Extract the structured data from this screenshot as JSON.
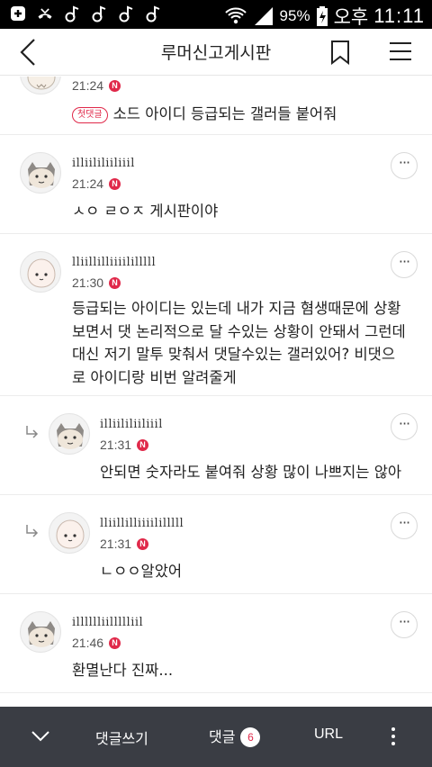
{
  "status_bar": {
    "battery": "95%",
    "ampm": "오후",
    "time": "11:11"
  },
  "header": {
    "title": "루머신고게시판"
  },
  "comments": [
    {
      "time": "21:24",
      "badge": "N",
      "first_tag": "첫댓글",
      "text": "소드 아이디 등급되는 갤러들 붙어줘"
    },
    {
      "username": "illiililiiliiil",
      "time": "21:24",
      "badge": "N",
      "text": "ㅅㅇ ㄹㅇㅈ 게시판이야",
      "more": "···"
    },
    {
      "username": "lliillilliiiililllll",
      "time": "21:30",
      "badge": "N",
      "lines": [
        "등급되는 아이디는 있는데 내가 지금 혐생때문에 상황",
        "보면서 댓 논리적으로 달 수있는 상황이 안돼서 그런데",
        "대신 저기 말투 맞춰서 댓달수있는 갤러있어? 비댓으",
        "로 아이디랑 비번 알려줄게"
      ],
      "more": "···"
    },
    {
      "username": "illiililiiliiil",
      "time": "21:31",
      "badge": "N",
      "text": "안되면 숫자라도 붙여줘 상황 많이 나쁘지는 않아",
      "more": "···"
    },
    {
      "username": "lliillilliiiililllll",
      "time": "21:31",
      "badge": "N",
      "text": "ㄴㅇㅇ알았어",
      "more": "···"
    },
    {
      "username": "illlllliillllliil",
      "time": "21:46",
      "badge": "N",
      "text": "환멸난다 진짜...",
      "more": "···"
    }
  ],
  "bottom_bar": {
    "write_label": "댓글쓰기",
    "comments_label": "댓글",
    "comments_count": "6",
    "url_label": "URL"
  }
}
